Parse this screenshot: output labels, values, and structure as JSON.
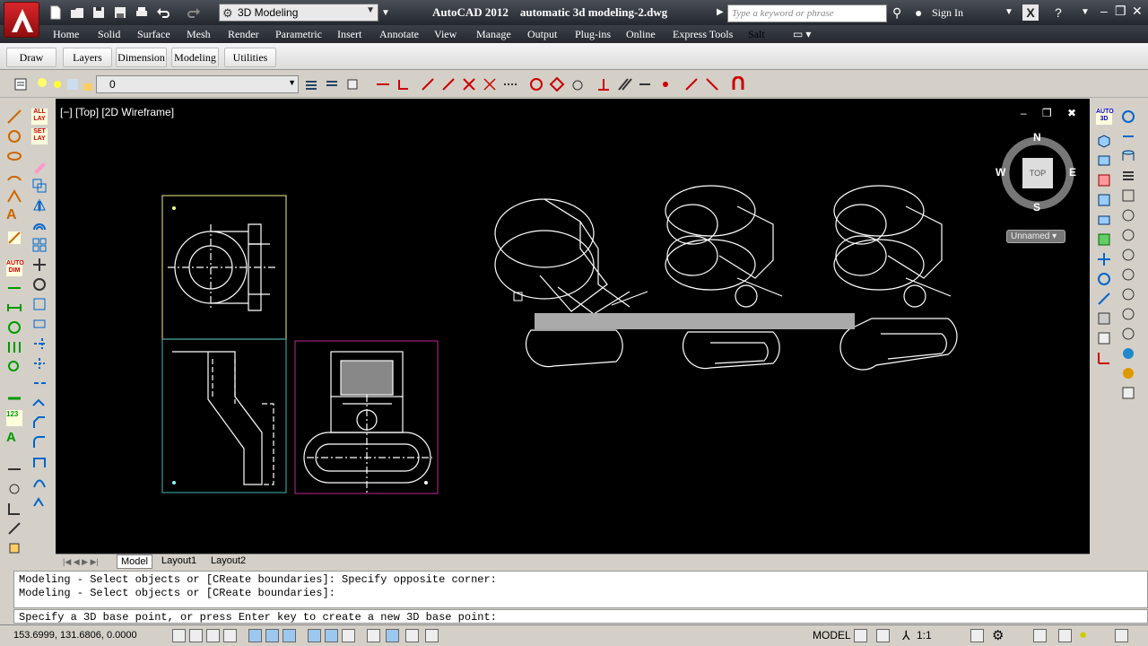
{
  "app": {
    "title": "AutoCAD 2012",
    "document": "automatic 3d modeling-2.dwg",
    "workspace": "3D Modeling"
  },
  "search": {
    "placeholder": "Type a keyword or phrase"
  },
  "account": {
    "sign_in": "Sign In"
  },
  "menu": [
    "Home",
    "Solid",
    "Surface",
    "Mesh",
    "Render",
    "Parametric",
    "Insert",
    "Annotate",
    "View",
    "Manage",
    "Output",
    "Plug-ins",
    "Online",
    "Express Tools",
    "Salt"
  ],
  "ribbon_panels": [
    "Draw",
    "Layers",
    "Dimension",
    "Modeling",
    "Utilities"
  ],
  "layer": {
    "current": "0"
  },
  "viewport": {
    "label": "[−] [Top] [2D Wireframe]",
    "controls": "– ❒ ✖"
  },
  "viewcube": {
    "face": "TOP",
    "north": "N",
    "south": "S",
    "east": "E",
    "west": "W",
    "ucs": "Unnamed"
  },
  "left_tool_labels": [
    "ALL LAY",
    "SET LAY",
    "AUTO DIM",
    "123"
  ],
  "right_tool_labels": [
    "AUTO 3D"
  ],
  "tabs": [
    "Model",
    "Layout1",
    "Layout2"
  ],
  "command_history": [
    "Modeling - Select objects or [CReate boundaries]: Specify opposite corner:",
    "Modeling - Select objects or [CReate boundaries]:"
  ],
  "command_prompt": "Specify a 3D base point, or press Enter key to create a new 3D base point:",
  "status": {
    "coordinates": "153.6999, 131.6806, 0.0000",
    "space": "MODEL",
    "annotation_scale": "1:1"
  },
  "colors": {
    "canvas": "#000000",
    "drawing": "#ffffff",
    "accent": "#c8161b",
    "viewport_left": "#c8c870",
    "viewport_front": "#3a9a9a",
    "viewport_right": "#a0207a"
  }
}
